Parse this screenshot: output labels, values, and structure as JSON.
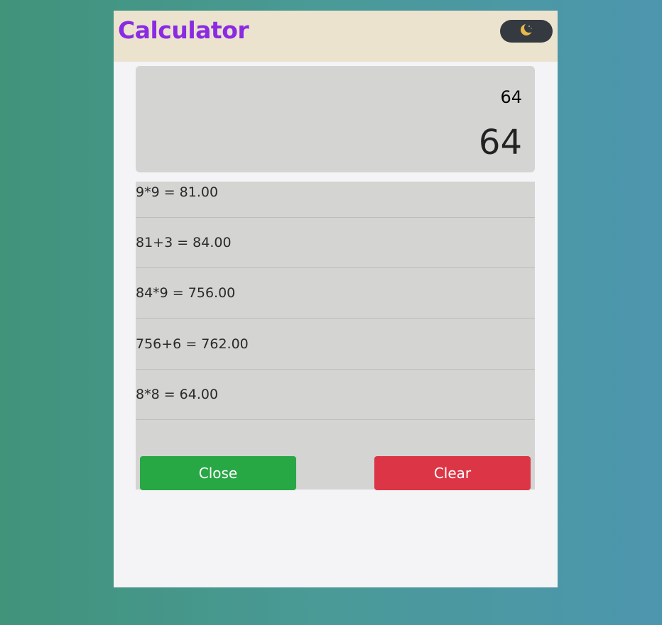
{
  "header": {
    "title": "Calculator",
    "theme_toggle_icon": "moon-icon"
  },
  "display": {
    "expression": "64",
    "result": "64"
  },
  "history": {
    "items": [
      "9*9 = 81.00",
      "81+3 = 84.00",
      "84*9 = 756.00",
      "756+6 = 762.00",
      "8*8 = 64.00"
    ],
    "close_label": "Close",
    "clear_label": "Clear"
  },
  "colors": {
    "title": "#8a2be2",
    "close": "#28a745",
    "clear": "#dc3545"
  }
}
